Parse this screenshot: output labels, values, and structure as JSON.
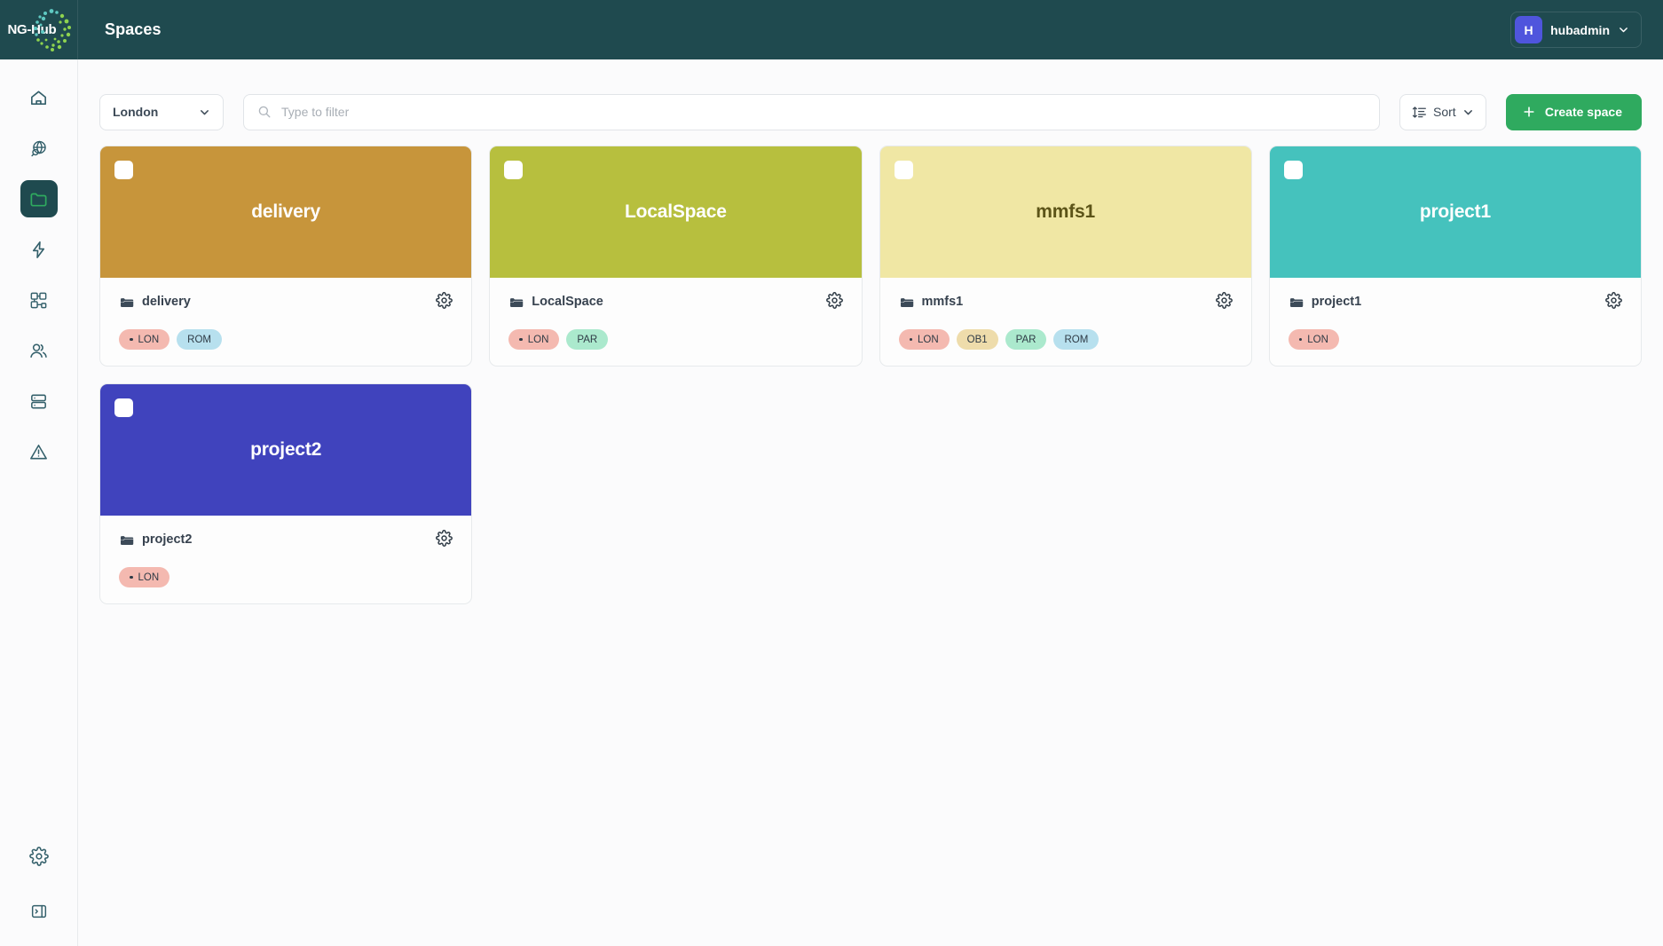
{
  "topbar": {
    "logo_text": "NG-Hub",
    "logo_icon": "nghub-dots-logo",
    "title": "Spaces",
    "user": {
      "initial": "H",
      "name": "hubadmin",
      "avatar_color": "#4f55dd",
      "chevron_icon": "chevron-down-icon"
    },
    "background": "#1f4a4f"
  },
  "sidebar": {
    "top_items": [
      {
        "name": "home",
        "icon": "home-icon",
        "active": false
      },
      {
        "name": "discover",
        "icon": "globe-search-icon",
        "active": false
      },
      {
        "name": "spaces",
        "icon": "folder-icon",
        "active": true
      },
      {
        "name": "activity",
        "icon": "lightning-bolt-icon",
        "active": false
      },
      {
        "name": "topology",
        "icon": "network-nodes-icon",
        "active": false
      },
      {
        "name": "users",
        "icon": "users-icon",
        "active": false
      },
      {
        "name": "storage",
        "icon": "server-stack-icon",
        "active": false
      },
      {
        "name": "alerts",
        "icon": "warning-triangle-icon",
        "active": false
      }
    ],
    "bottom_items": [
      {
        "name": "settings",
        "icon": "gear-icon",
        "active": false
      },
      {
        "name": "collapse-panel",
        "icon": "panel-toggle-icon",
        "active": false
      }
    ],
    "active_bg": "#1f4a4f",
    "active_fg": "#2faa5f"
  },
  "toolbar": {
    "site_select": {
      "value": "London",
      "chevron_icon": "chevron-down-icon"
    },
    "filter": {
      "value": "",
      "placeholder": "Type to filter",
      "icon": "search-icon"
    },
    "sort": {
      "label": "Sort",
      "icon": "sort-icon",
      "chevron_icon": "chevron-down-icon"
    },
    "create": {
      "label": "Create space",
      "icon": "plus-icon",
      "color": "#2faa5f"
    }
  },
  "spaces": [
    {
      "title": "delivery",
      "name": "delivery",
      "banner_color": "#c7953b",
      "title_color": "#ffffff",
      "folder_icon": "folder-icon",
      "gear_icon": "gear-icon",
      "checkbox_checked": false,
      "tags": [
        {
          "label": "LON",
          "color": "#f4b9b0",
          "dot": true
        },
        {
          "label": "ROM",
          "color": "#b7e0ee",
          "dot": false
        }
      ]
    },
    {
      "title": "LocalSpace",
      "name": "LocalSpace",
      "banner_color": "#b7bf3e",
      "title_color": "#ffffff",
      "folder_icon": "folder-icon",
      "gear_icon": "gear-icon",
      "checkbox_checked": false,
      "tags": [
        {
          "label": "LON",
          "color": "#f4b9b0",
          "dot": true
        },
        {
          "label": "PAR",
          "color": "#abe9cd",
          "dot": false
        }
      ]
    },
    {
      "title": "mmfs1",
      "name": "mmfs1",
      "banner_color": "#f0e7a4",
      "title_color": "#5c5418",
      "folder_icon": "folder-icon",
      "gear_icon": "gear-icon",
      "checkbox_checked": false,
      "tags": [
        {
          "label": "LON",
          "color": "#f4b9b0",
          "dot": true
        },
        {
          "label": "OB1",
          "color": "#eedcab",
          "dot": false
        },
        {
          "label": "PAR",
          "color": "#abe9cd",
          "dot": false
        },
        {
          "label": "ROM",
          "color": "#b7e0ee",
          "dot": false
        }
      ]
    },
    {
      "title": "project1",
      "name": "project1",
      "banner_color": "#45c2bd",
      "title_color": "#ffffff",
      "folder_icon": "folder-icon",
      "gear_icon": "gear-icon",
      "checkbox_checked": false,
      "tags": [
        {
          "label": "LON",
          "color": "#f4b9b0",
          "dot": true
        }
      ]
    },
    {
      "title": "project2",
      "name": "project2",
      "banner_color": "#4043bd",
      "title_color": "#ffffff",
      "folder_icon": "folder-icon",
      "gear_icon": "gear-icon",
      "checkbox_checked": false,
      "tags": [
        {
          "label": "LON",
          "color": "#f4b9b0",
          "dot": true
        }
      ]
    }
  ]
}
